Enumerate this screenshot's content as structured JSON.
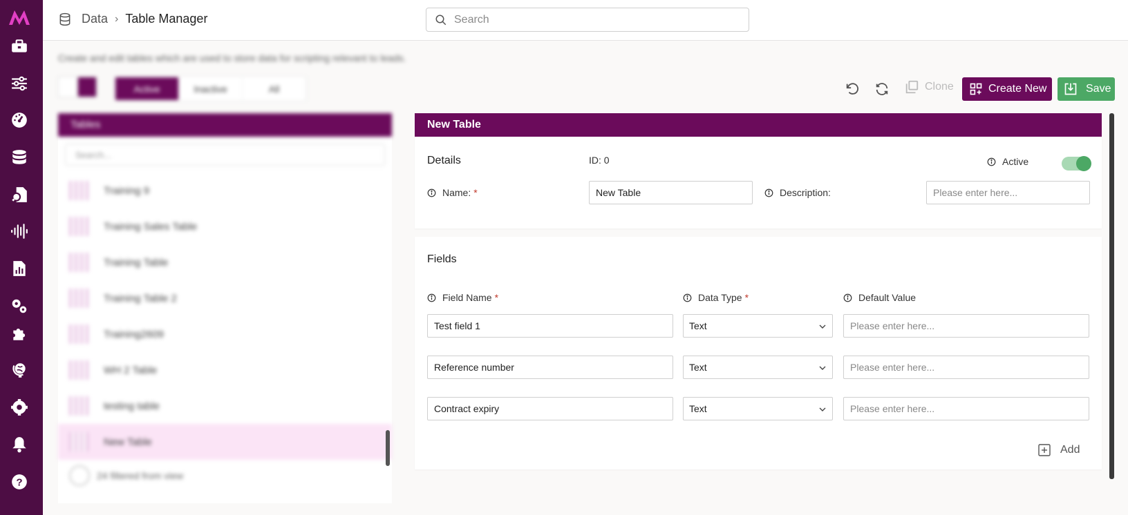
{
  "app": {
    "logo": "M"
  },
  "breadcrumb": {
    "root": "Data",
    "separator": "›",
    "current": "Table Manager"
  },
  "search": {
    "placeholder": "Search"
  },
  "page": {
    "subtitle": "Create and edit tables which are used to store data for scripting relevant to leads."
  },
  "filters": {
    "tabs": [
      "Active",
      "Inactive",
      "All"
    ]
  },
  "list": {
    "header": "Tables",
    "search_placeholder": "Search...",
    "items": [
      "Training 9",
      "Training Sales Table",
      "Training Table",
      "Training Table 2",
      "Training2609",
      "WH 2 Table",
      "testing table",
      "New Table"
    ],
    "footer": "24 filtered from view"
  },
  "toolbar": {
    "clone_label": "Clone",
    "create_label": "Create New",
    "save_label": "Save"
  },
  "editor": {
    "title": "New Table",
    "details": {
      "title": "Details",
      "id_label": "ID: 0",
      "active_label": "Active",
      "active": true,
      "name_label": "Name:",
      "name_required": "*",
      "name_value": "New Table",
      "description_label": "Description:",
      "description_placeholder": "Please enter here..."
    },
    "fields": {
      "title": "Fields",
      "col_field_name": "Field Name",
      "col_data_type": "Data Type",
      "col_default_value": "Default Value",
      "required": "*",
      "rows": [
        {
          "name": "Test field 1",
          "type": "Text",
          "default_placeholder": "Please enter here..."
        },
        {
          "name": "Reference number",
          "type": "Text",
          "default_placeholder": "Please enter here..."
        },
        {
          "name": "Contract expiry",
          "type": "Text",
          "default_placeholder": "Please enter here..."
        }
      ],
      "add_label": "Add"
    }
  },
  "colors": {
    "sidebar": "#4d0d44",
    "brand": "#6b0b5b",
    "accent_logo": "#e23fc4",
    "success": "#4ca865",
    "selected_row": "#fbe4f6"
  },
  "icons": [
    "briefcase-icon",
    "sliders-icon",
    "dashboard-gauge-icon",
    "database-icon",
    "file-search-icon",
    "audio-wave-icon",
    "report-icon",
    "gears-icon",
    "puzzle-icon",
    "globe-icon",
    "settings-icon",
    "bell-icon",
    "help-icon"
  ]
}
